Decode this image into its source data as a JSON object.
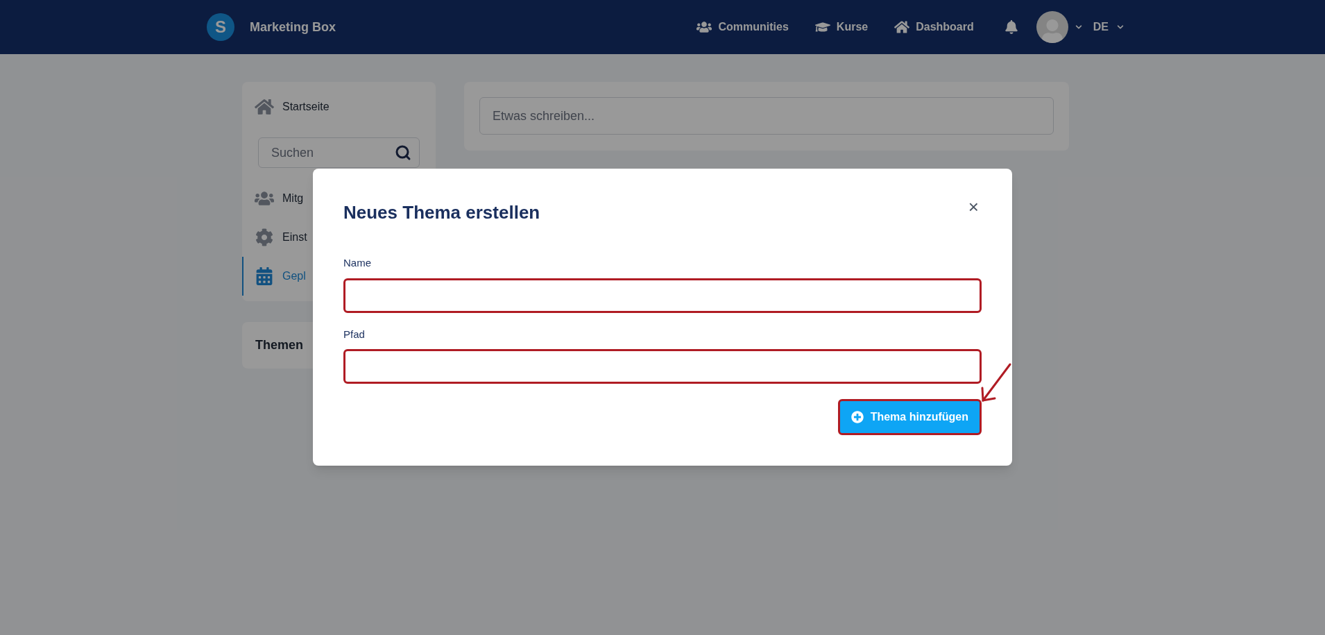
{
  "header": {
    "logo_letter": "S",
    "brand": "Marketing Box",
    "nav": [
      {
        "kind": "users",
        "label": "Communities"
      },
      {
        "kind": "cap",
        "label": "Kurse"
      },
      {
        "kind": "home",
        "label": "Dashboard"
      }
    ],
    "language": "DE"
  },
  "sidebar": {
    "items": [
      {
        "kind": "home",
        "label": "Startseite",
        "selected": false
      },
      {
        "kind": "search",
        "placeholder": "Suchen"
      },
      {
        "kind": "users",
        "label": "Mitg",
        "selected": false
      },
      {
        "kind": "gear",
        "label": "Einst",
        "selected": false
      },
      {
        "kind": "calendar",
        "label": "Gepl",
        "selected": true
      }
    ],
    "topics_title": "Themen"
  },
  "composer": {
    "placeholder": "Etwas schreiben..."
  },
  "dialog": {
    "title": "Neues Thema erstellen",
    "close": "×",
    "fields": [
      {
        "label": "Name"
      },
      {
        "label": "Pfad"
      }
    ],
    "submit": "Thema hinzufügen"
  }
}
